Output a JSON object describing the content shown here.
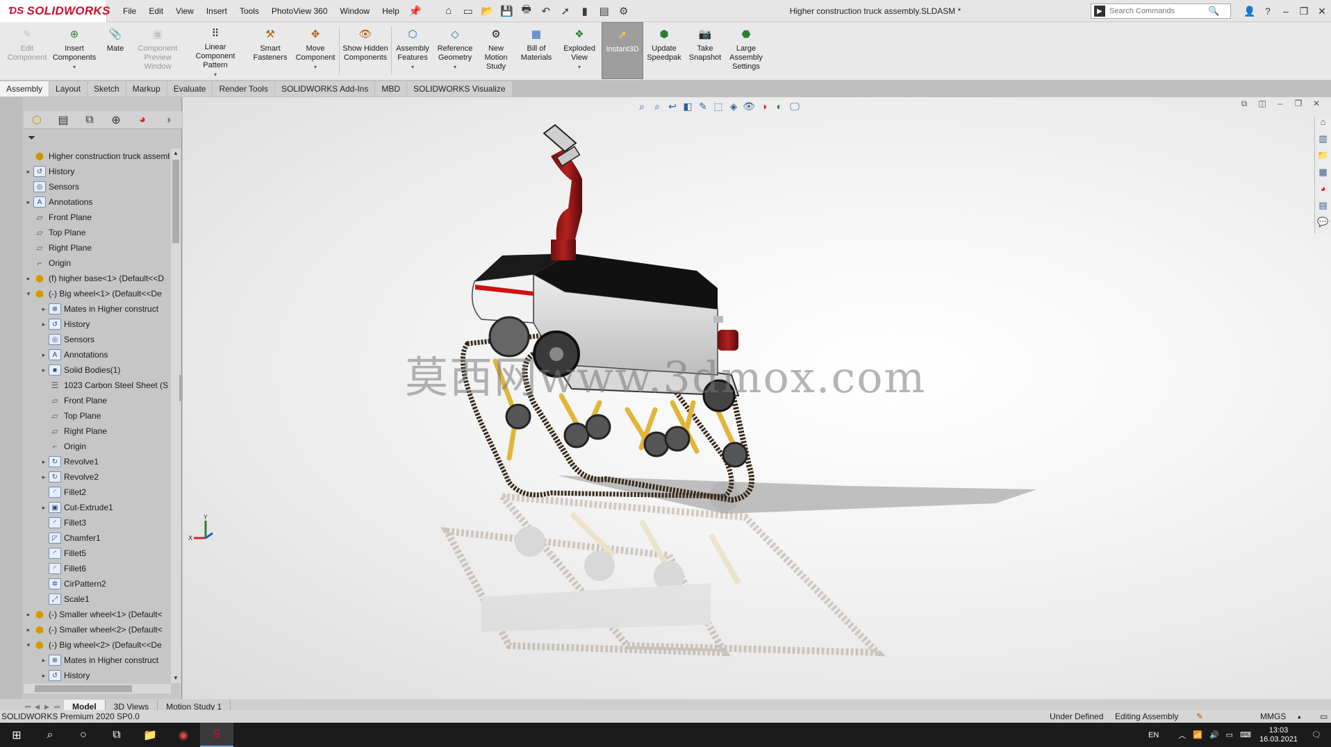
{
  "app": {
    "logo": "SOLIDWORKS",
    "document_title": "Higher construction truck assembly.SLDASM *"
  },
  "menu": [
    "File",
    "Edit",
    "View",
    "Insert",
    "Tools",
    "PhotoView 360",
    "Window",
    "Help"
  ],
  "search": {
    "placeholder": "Search Commands"
  },
  "commands": [
    {
      "label": "Edit Component",
      "icon": "edit-component-icon",
      "disabled": true
    },
    {
      "label": "Insert Components",
      "icon": "insert-components-icon",
      "disabled": false
    },
    {
      "label": "Mate",
      "icon": "mate-icon",
      "disabled": false
    },
    {
      "label": "Component Preview Window",
      "icon": "component-preview-icon",
      "disabled": true
    },
    {
      "label": "Linear Component Pattern",
      "icon": "linear-pattern-icon",
      "disabled": false
    },
    {
      "label": "Smart Fasteners",
      "icon": "smart-fasteners-icon",
      "disabled": false
    },
    {
      "label": "Move Component",
      "icon": "move-component-icon",
      "disabled": false
    },
    {
      "label": "Show Hidden Components",
      "icon": "show-hidden-icon",
      "disabled": false
    },
    {
      "label": "Assembly Features",
      "icon": "assembly-features-icon",
      "disabled": false
    },
    {
      "label": "Reference Geometry",
      "icon": "reference-geometry-icon",
      "disabled": false
    },
    {
      "label": "New Motion Study",
      "icon": "motion-study-icon",
      "disabled": false
    },
    {
      "label": "Bill of Materials",
      "icon": "bom-icon",
      "disabled": false
    },
    {
      "label": "Exploded View",
      "icon": "exploded-view-icon",
      "disabled": false
    },
    {
      "label": "Instant3D",
      "icon": "instant3d-icon",
      "disabled": false,
      "active": true
    },
    {
      "label": "Update Speedpak",
      "icon": "speedpak-icon",
      "disabled": false
    },
    {
      "label": "Take Snapshot",
      "icon": "snapshot-icon",
      "disabled": false
    },
    {
      "label": "Large Assembly Settings",
      "icon": "large-assembly-icon",
      "disabled": false
    }
  ],
  "cm_tabs": [
    "Assembly",
    "Layout",
    "Sketch",
    "Markup",
    "Evaluate",
    "Render Tools",
    "SOLIDWORKS Add-Ins",
    "MBD",
    "SOLIDWORKS Visualize"
  ],
  "tree": {
    "root": "Higher construction truck assembly",
    "nodes": [
      {
        "label": "History",
        "level": 1,
        "arrow": "▸",
        "icon": "history-icon"
      },
      {
        "label": "Sensors",
        "level": 1,
        "arrow": "",
        "icon": "sensor-icon"
      },
      {
        "label": "Annotations",
        "level": 1,
        "arrow": "▸",
        "icon": "annotations-icon"
      },
      {
        "label": "Front Plane",
        "level": 1,
        "arrow": "",
        "icon": "plane-icon"
      },
      {
        "label": "Top Plane",
        "level": 1,
        "arrow": "",
        "icon": "plane-icon"
      },
      {
        "label": "Right Plane",
        "level": 1,
        "arrow": "",
        "icon": "plane-icon"
      },
      {
        "label": "Origin",
        "level": 1,
        "arrow": "",
        "icon": "origin-icon"
      },
      {
        "label": "(f) higher base<1> (Default<<D",
        "level": 1,
        "arrow": "▸",
        "icon": "part-icon"
      },
      {
        "label": "(-) Big wheel<1> (Default<<De",
        "level": 1,
        "arrow": "▾",
        "icon": "part-icon"
      },
      {
        "label": "Mates in Higher construct",
        "level": 2,
        "arrow": "▸",
        "icon": "mates-icon"
      },
      {
        "label": "History",
        "level": 2,
        "arrow": "▸",
        "icon": "history-icon"
      },
      {
        "label": "Sensors",
        "level": 2,
        "arrow": "",
        "icon": "sensor-icon"
      },
      {
        "label": "Annotations",
        "level": 2,
        "arrow": "▸",
        "icon": "annotations-icon"
      },
      {
        "label": "Solid Bodies(1)",
        "level": 2,
        "arrow": "▸",
        "icon": "solid-bodies-icon"
      },
      {
        "label": "1023 Carbon Steel Sheet (S",
        "level": 2,
        "arrow": "",
        "icon": "material-icon"
      },
      {
        "label": "Front Plane",
        "level": 2,
        "arrow": "",
        "icon": "plane-icon"
      },
      {
        "label": "Top Plane",
        "level": 2,
        "arrow": "",
        "icon": "plane-icon"
      },
      {
        "label": "Right Plane",
        "level": 2,
        "arrow": "",
        "icon": "plane-icon"
      },
      {
        "label": "Origin",
        "level": 2,
        "arrow": "",
        "icon": "origin-icon"
      },
      {
        "label": "Revolve1",
        "level": 2,
        "arrow": "▸",
        "icon": "revolve-icon"
      },
      {
        "label": "Revolve2",
        "level": 2,
        "arrow": "▸",
        "icon": "revolve-icon"
      },
      {
        "label": "Fillet2",
        "level": 2,
        "arrow": "",
        "icon": "fillet-icon"
      },
      {
        "label": "Cut-Extrude1",
        "level": 2,
        "arrow": "▸",
        "icon": "cut-extrude-icon"
      },
      {
        "label": "Fillet3",
        "level": 2,
        "arrow": "",
        "icon": "fillet-icon"
      },
      {
        "label": "Chamfer1",
        "level": 2,
        "arrow": "",
        "icon": "chamfer-icon"
      },
      {
        "label": "Fillet5",
        "level": 2,
        "arrow": "",
        "icon": "fillet-icon"
      },
      {
        "label": "Fillet6",
        "level": 2,
        "arrow": "",
        "icon": "fillet-icon"
      },
      {
        "label": "CirPattern2",
        "level": 2,
        "arrow": "",
        "icon": "circular-pattern-icon"
      },
      {
        "label": "Scale1",
        "level": 2,
        "arrow": "",
        "icon": "scale-icon"
      },
      {
        "label": "(-) Smaller wheel<1> (Default<",
        "level": 1,
        "arrow": "▸",
        "icon": "part-icon"
      },
      {
        "label": "(-) Smaller wheel<2> (Default<",
        "level": 1,
        "arrow": "▸",
        "icon": "part-icon"
      },
      {
        "label": "(-) Big wheel<2> (Default<<De",
        "level": 1,
        "arrow": "▾",
        "icon": "part-icon"
      },
      {
        "label": "Mates in Higher construct",
        "level": 2,
        "arrow": "▸",
        "icon": "mates-icon"
      },
      {
        "label": "History",
        "level": 2,
        "arrow": "▸",
        "icon": "history-icon"
      }
    ]
  },
  "model_tabs": [
    "Model",
    "3D Views",
    "Motion Study 1"
  ],
  "status": {
    "product": "SOLIDWORKS Premium 2020 SP0.0",
    "definition": "Under Defined",
    "mode": "Editing Assembly",
    "units": "MMGS"
  },
  "watermark": "莫西网www.3dmox.com",
  "taskbar": {
    "language": "EN",
    "time": "13:03",
    "date": "16.03.2021"
  },
  "colors": {
    "brand": "#c8102e",
    "truck_body": "#d9d9d9",
    "truck_top": "#111111",
    "stripe": "#d01010",
    "turret": "#8b1414",
    "legs": "#e0b53a",
    "track": "#3a2a1a"
  }
}
